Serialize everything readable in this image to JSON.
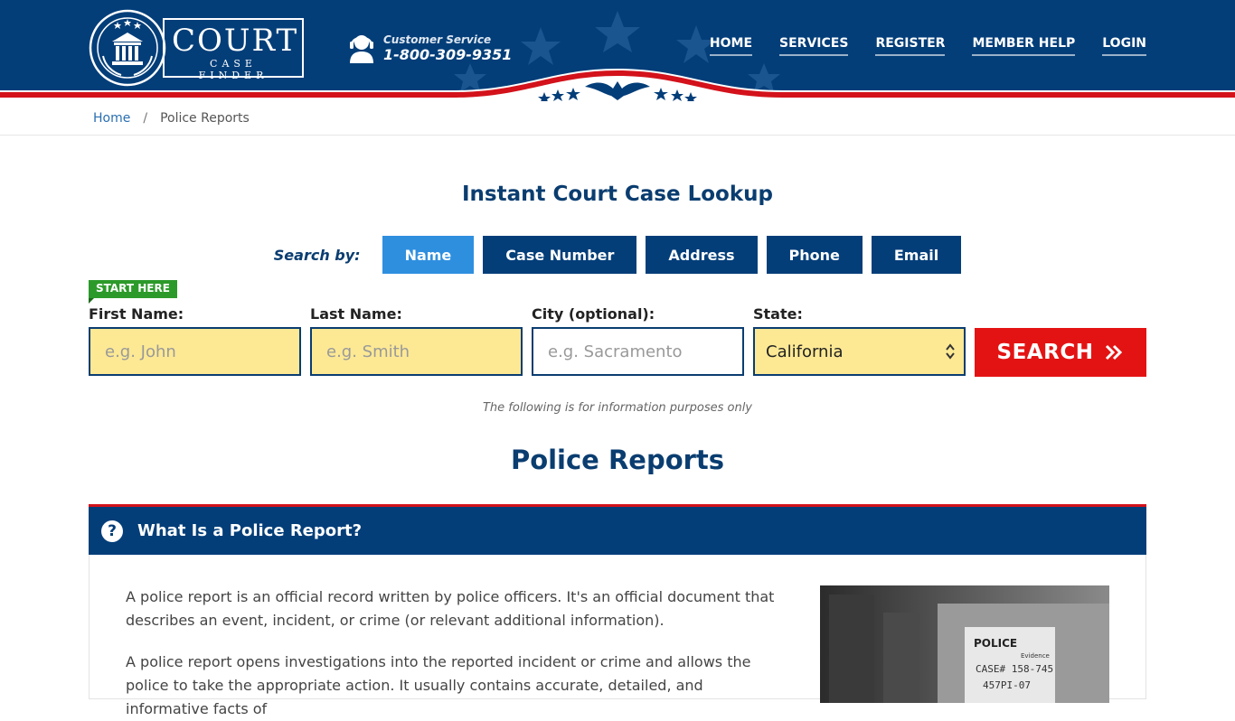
{
  "header": {
    "logo": {
      "court": "COURT",
      "finder": "CASE FINDER"
    },
    "customer_service": {
      "label": "Customer Service",
      "phone": "1-800-309-9351"
    },
    "nav": [
      "HOME",
      "SERVICES",
      "REGISTER",
      "MEMBER HELP",
      "LOGIN"
    ]
  },
  "breadcrumb": {
    "home": "Home",
    "separator": "/",
    "current": "Police Reports"
  },
  "lookup": {
    "title": "Instant Court Case Lookup",
    "search_by_label": "Search by:",
    "tabs": [
      "Name",
      "Case Number",
      "Address",
      "Phone",
      "Email"
    ],
    "active_tab": "Name",
    "start_here": "START HERE",
    "fields": {
      "first_name": {
        "label": "First Name:",
        "placeholder": "e.g. John"
      },
      "last_name": {
        "label": "Last Name:",
        "placeholder": "e.g. Smith"
      },
      "city": {
        "label": "City (optional):",
        "placeholder": "e.g.  Sacramento"
      },
      "state": {
        "label": "State:",
        "value": "California"
      }
    },
    "search_button": "SEARCH",
    "info_note": "The following is for information purposes only"
  },
  "page": {
    "title": "Police Reports",
    "section_title": "What Is a Police Report?",
    "para1": "A police report is an official record written by police officers. It's an official document that describes an event, incident, or crime (or relevant additional information).",
    "para2": "A police report opens investigations into the reported incident or crime and allows the police to take the appropriate action. It usually contains accurate, detailed, and informative facts of",
    "photo_text": {
      "police": "POLICE",
      "evidence": "Evidence",
      "case": "CASE# 158-745",
      "code": "457PI-07"
    }
  },
  "colors": {
    "navy": "#033e79",
    "active_tab": "#2f8fdf",
    "search_red": "#e41313",
    "input_yellow": "#fde994",
    "badge_green": "#2c9a2a"
  }
}
